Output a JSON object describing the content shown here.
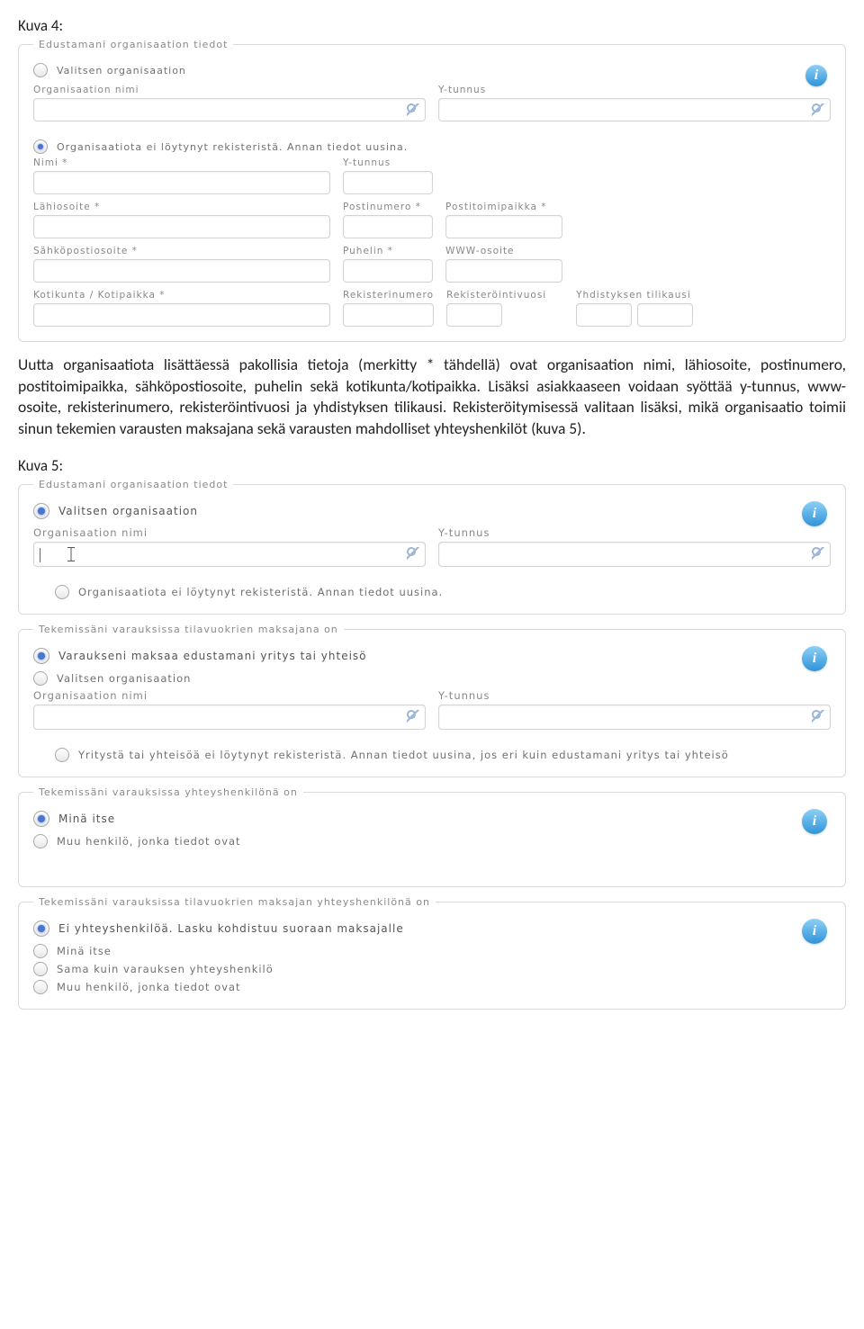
{
  "captions": {
    "kuva4": "Kuva 4:",
    "kuva5": "Kuva 5:"
  },
  "paragraph": "Uutta organisaatiota lisättäessä pakollisia tietoja (merkitty * tähdellä) ovat organisaation nimi, lähiosoite, postinumero, postitoimipaikka, sähköpostiosoite, puhelin sekä kotikunta/kotipaikka. Lisäksi asiakkaaseen voidaan syöttää y-tunnus, www-osoite, rekisterinumero, rekisteröintivuosi ja yhdistyksen tilikausi. Rekisteröitymisessä valitaan lisäksi, mikä organisaatio toimii sinun tekemien varausten maksajana sekä varausten mahdolliset yhteyshenkilöt (kuva 5).",
  "info_glyph": "i",
  "panel1": {
    "legend": "Edustamani organisaation tiedot",
    "opt_select": "Valitsen organisaation",
    "opt_new": "Organisaatiota ei löytynyt rekisteristä. Annan tiedot uusina.",
    "top": {
      "org_nimi": "Organisaation nimi",
      "ytunnus": "Y-tunnus"
    },
    "fields": {
      "nimi": "Nimi *",
      "ytunnus": "Y-tunnus",
      "lahiosoite": "Lähiosoite *",
      "postinumero": "Postinumero *",
      "postitoimipaikka": "Postitoimipaikka *",
      "sahkoposti": "Sähköpostiosoite *",
      "puhelin": "Puhelin *",
      "www": "WWW-osoite",
      "kotikunta": "Kotikunta / Kotipaikka *",
      "rekisterinumero": "Rekisterinumero",
      "rekisterointivuosi": "Rekisteröintivuosi",
      "tilikausi": "Yhdistyksen tilikausi"
    }
  },
  "panel2a": {
    "legend": "Edustamani organisaation tiedot",
    "opt_select": "Valitsen organisaation",
    "opt_new": "Organisaatiota ei löytynyt rekisteristä. Annan tiedot uusina.",
    "org_nimi": "Organisaation nimi",
    "ytunnus": "Y-tunnus"
  },
  "panel2b": {
    "legend": "Tekemissäni varauksissa tilavuokrien maksajana on",
    "opt1": "Varaukseni maksaa edustamani yritys tai yhteisö",
    "opt2": "Valitsen organisaation",
    "opt3": "Yritystä tai yhteisöä ei löytynyt rekisteristä. Annan tiedot uusina, jos eri kuin edustamani yritys tai yhteisö",
    "org_nimi": "Organisaation nimi",
    "ytunnus": "Y-tunnus"
  },
  "panel2c": {
    "legend": "Tekemissäni varauksissa yhteyshenkilönä on",
    "opt1": "Minä itse",
    "opt2": "Muu henkilö, jonka tiedot ovat"
  },
  "panel2d": {
    "legend": "Tekemissäni varauksissa tilavuokrien maksajan yhteyshenkilönä on",
    "opt1": "Ei yhteyshenkilöä. Lasku kohdistuu suoraan maksajalle",
    "opt2": "Minä itse",
    "opt3": "Sama kuin varauksen yhteyshenkilö",
    "opt4": "Muu henkilö, jonka tiedot ovat"
  }
}
